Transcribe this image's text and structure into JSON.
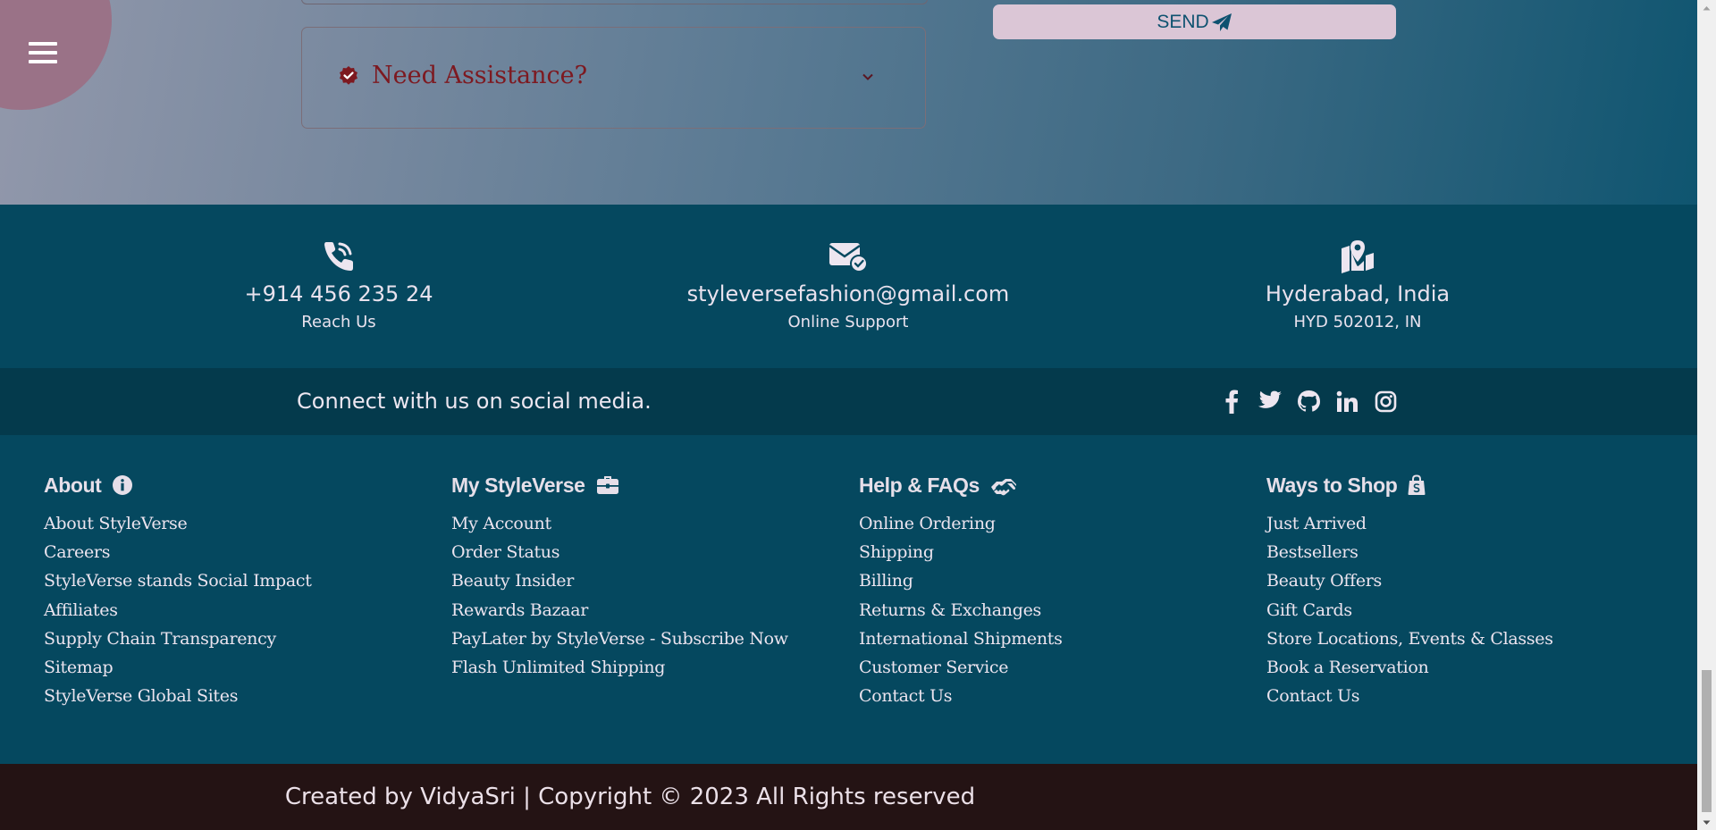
{
  "assistance": {
    "title": "Need Assistance?"
  },
  "send_button": {
    "label": "SEND"
  },
  "contact": [
    {
      "icon": "phone-icon",
      "main": "+914 456 235 24",
      "sub": "Reach Us"
    },
    {
      "icon": "envelope-check-icon",
      "main": "styleversefashion@gmail.com",
      "sub": "Online Support"
    },
    {
      "icon": "map-location-icon",
      "main": "Hyderabad, India",
      "sub": "HYD 502012, IN"
    }
  ],
  "social": {
    "text": "Connect with us on social media.",
    "icons": [
      "facebook-icon",
      "twitter-icon",
      "github-icon",
      "linkedin-icon",
      "instagram-icon"
    ]
  },
  "columns": [
    {
      "title": "About",
      "icon": "info-icon",
      "items": [
        "About StyleVerse",
        "Careers",
        "StyleVerse stands Social Impact",
        "Affiliates",
        "Supply Chain Transparency",
        "Sitemap",
        "StyleVerse Global Sites"
      ]
    },
    {
      "title": "My StyleVerse",
      "icon": "briefcase-icon",
      "items": [
        "My Account",
        "Order Status",
        "Beauty Insider",
        "Rewards Bazaar",
        "PayLater by StyleVerse - Subscribe Now",
        "Flash Unlimited Shipping"
      ]
    },
    {
      "title": "Help & FAQs",
      "icon": "handshake-icon",
      "items": [
        "Online Ordering",
        "Shipping",
        "Billing",
        "Returns & Exchanges",
        "International Shipments",
        "Customer Service",
        "Contact Us"
      ]
    },
    {
      "title": "Ways to Shop",
      "icon": "shopping-bag-icon",
      "items": [
        "Just Arrived",
        "Bestsellers",
        "Beauty Offers",
        "Gift Cards",
        "Store Locations, Events & Classes",
        "Book a Reservation",
        "Contact Us"
      ]
    }
  ],
  "footer": {
    "copyright": "Created by VidyaSri | Copyright © 2023 All Rights reserved"
  },
  "colors": {
    "footer_bg": "#05485f",
    "social_bar_bg": "#043a4c",
    "bottom_bar_bg": "#241314",
    "send_button_bg": "#dbc6d6",
    "assist_text": "#7d1920",
    "menu_blob": "#9a7287"
  }
}
